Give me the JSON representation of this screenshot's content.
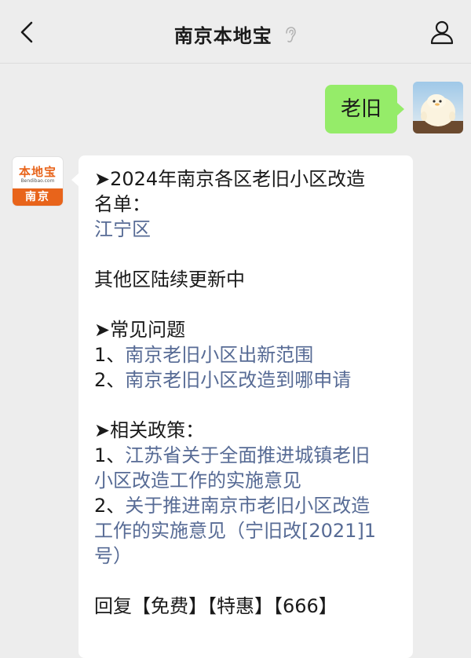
{
  "header": {
    "title": "南京本地宝",
    "back_icon": "chevron-left-icon",
    "ear_icon": "ear-icon",
    "profile_icon": "person-icon"
  },
  "messages": {
    "user_text": "老旧",
    "bot_avatar": {
      "logo_text": "本地宝",
      "logo_domain": "Bendibao.com",
      "city": "南京",
      "accent": "#e8641b"
    },
    "bot": {
      "heading1_line1": "➤2024年南京各区老旧小区改造",
      "heading1_line2": "名单：",
      "district_link": "江宁区",
      "update_note": "其他区陆续更新中",
      "heading2": "➤常见问题",
      "faq1_prefix": "1、",
      "faq1_link": "南京老旧小区出新范围",
      "faq2_prefix": "2、",
      "faq2_link": "南京老旧小区改造到哪申请",
      "heading3": "➤相关政策：",
      "policy1_prefix": "1、",
      "policy1_link_a": "江苏省关于全面推进城镇老旧",
      "policy1_link_b": "小区改造工作的实施意见",
      "policy2_prefix": "2、",
      "policy2_link_a": "关于推进南京市老旧小区改造",
      "policy2_link_b": "工作的实施意见（宁旧改[2021]1",
      "policy2_link_c": "号）",
      "reply_line": "回复【免费】【特惠】【666】"
    }
  },
  "colors": {
    "bg": "#ededed",
    "outgoing_bubble": "#95ec69",
    "incoming_bubble": "#ffffff",
    "link": "#576b95"
  }
}
